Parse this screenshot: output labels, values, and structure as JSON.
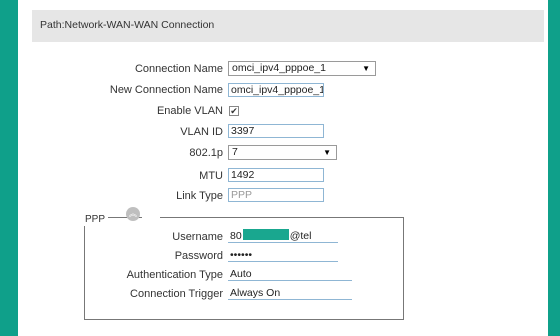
{
  "path": "Path:Network-WAN-WAN Connection",
  "form": {
    "connection_name": {
      "label": "Connection Name",
      "value": "omci_ipv4_pppoe_1"
    },
    "new_connection_name": {
      "label": "New Connection Name",
      "value": "omci_ipv4_pppoe_1"
    },
    "enable_vlan": {
      "label": "Enable VLAN",
      "checked": true
    },
    "vlan_id": {
      "label": "VLAN ID",
      "value": "3397"
    },
    "dot1p": {
      "label": "802.1p",
      "value": "7"
    },
    "mtu": {
      "label": "MTU",
      "value": "1492"
    },
    "link_type": {
      "label": "Link Type",
      "value": "PPP"
    }
  },
  "ppp": {
    "title": "PPP",
    "username": {
      "label": "Username",
      "prefix": "80",
      "suffix": "@tel"
    },
    "password": {
      "label": "Password",
      "value": "••••••"
    },
    "auth_type": {
      "label": "Authentication Type",
      "value": "Auto"
    },
    "conn_trigger": {
      "label": "Connection Trigger",
      "value": "Always On"
    }
  },
  "colors": {
    "background": "#0fa08a",
    "field_border": "#8fb6d4",
    "redaction": "#19a78f"
  }
}
